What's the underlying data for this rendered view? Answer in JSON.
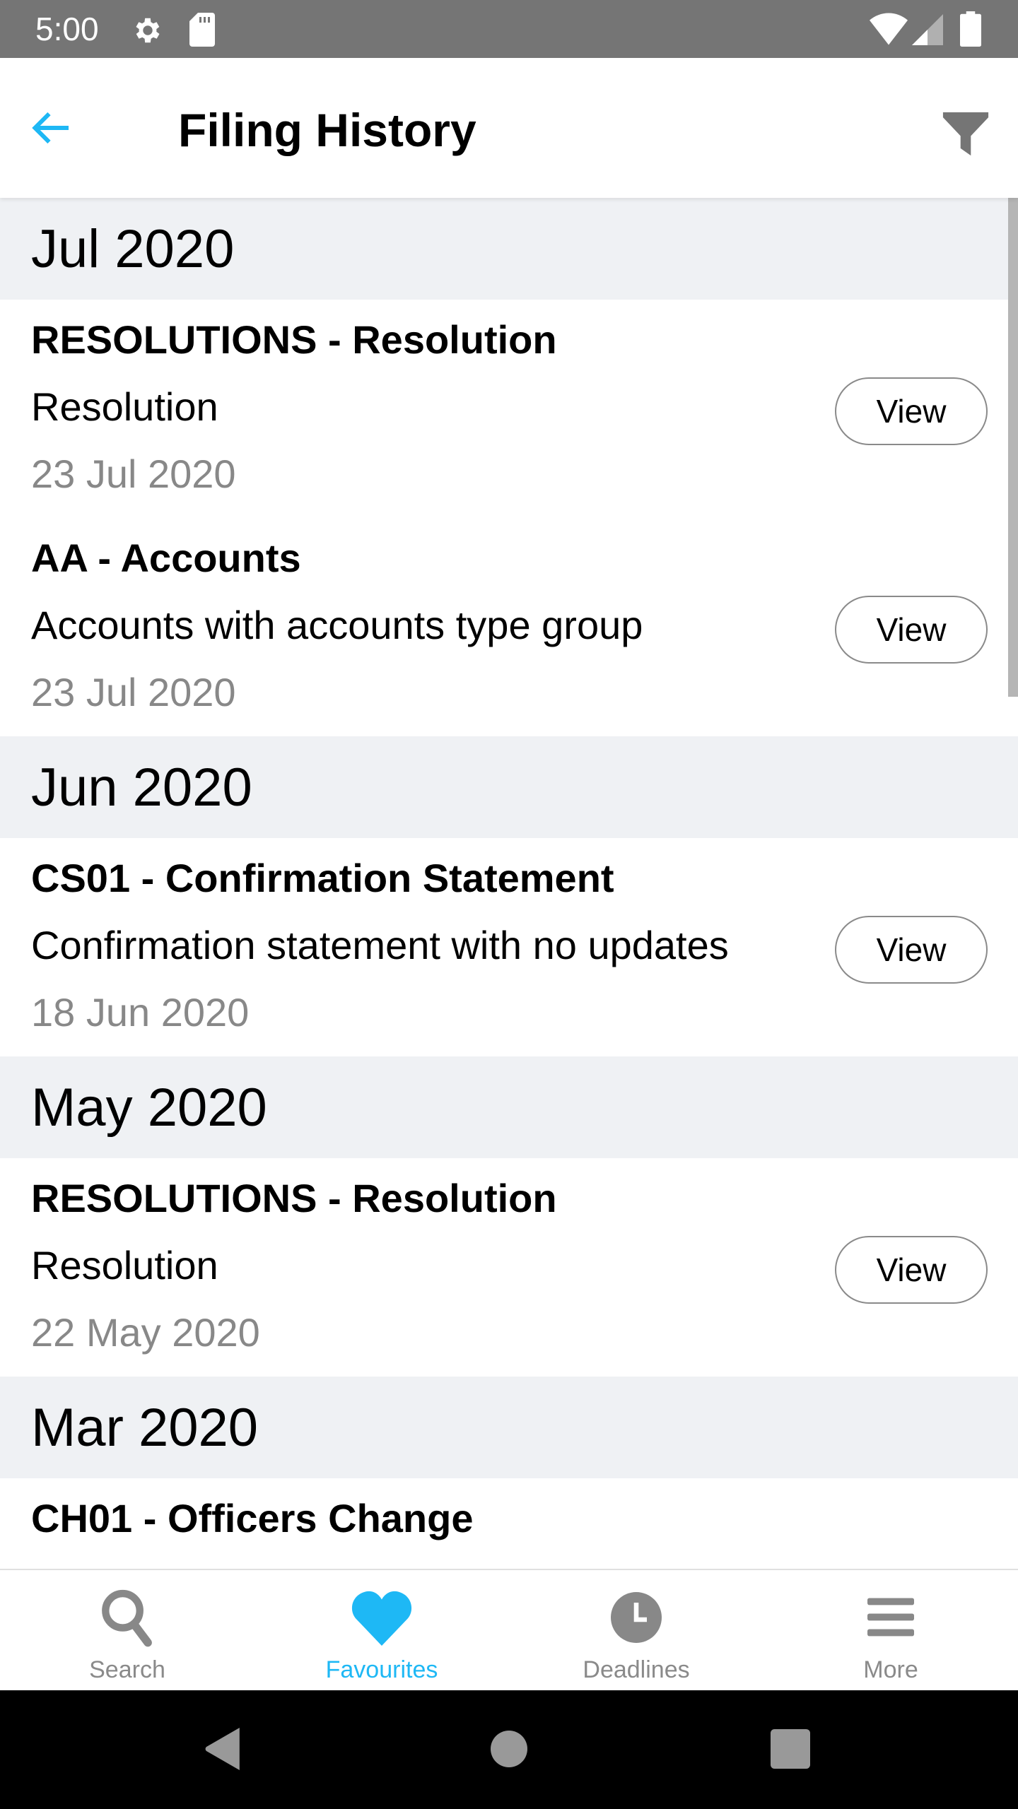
{
  "status_bar": {
    "time": "5:00",
    "icons": [
      "settings-icon",
      "sd-card-icon",
      "wifi-icon",
      "cell-signal-icon",
      "battery-icon"
    ]
  },
  "app_bar": {
    "title": "Filing History",
    "back_icon": "arrow-left-icon",
    "filter_icon": "filter-icon",
    "accent_color": "#1eb8f5"
  },
  "sections": [
    {
      "month": "Jul 2020",
      "items": [
        {
          "title": "RESOLUTIONS - Resolution",
          "description": "Resolution",
          "date": "23 Jul 2020",
          "button": "View"
        },
        {
          "title": "AA - Accounts",
          "description": "Accounts with accounts type group",
          "date": "23 Jul 2020",
          "button": "View"
        }
      ]
    },
    {
      "month": "Jun 2020",
      "items": [
        {
          "title": "CS01 - Confirmation Statement",
          "description": "Confirmation statement with no updates",
          "date": "18 Jun 2020",
          "button": "View"
        }
      ]
    },
    {
      "month": "May 2020",
      "items": [
        {
          "title": "RESOLUTIONS - Resolution",
          "description": "Resolution",
          "date": "22 May 2020",
          "button": "View"
        }
      ]
    },
    {
      "month": "Mar 2020",
      "items": [
        {
          "title": "CH01 - Officers Change"
        }
      ]
    }
  ],
  "bottom_nav": {
    "items": [
      {
        "label": "Search",
        "icon": "search-icon",
        "active": false
      },
      {
        "label": "Favourites",
        "icon": "heart-icon",
        "active": true
      },
      {
        "label": "Deadlines",
        "icon": "clock-icon",
        "active": false
      },
      {
        "label": "More",
        "icon": "menu-icon",
        "active": false
      }
    ],
    "active_color": "#1eb8f5",
    "inactive_color": "#8a8a8a"
  },
  "system_nav": {
    "buttons": [
      "back",
      "home",
      "recents"
    ]
  }
}
